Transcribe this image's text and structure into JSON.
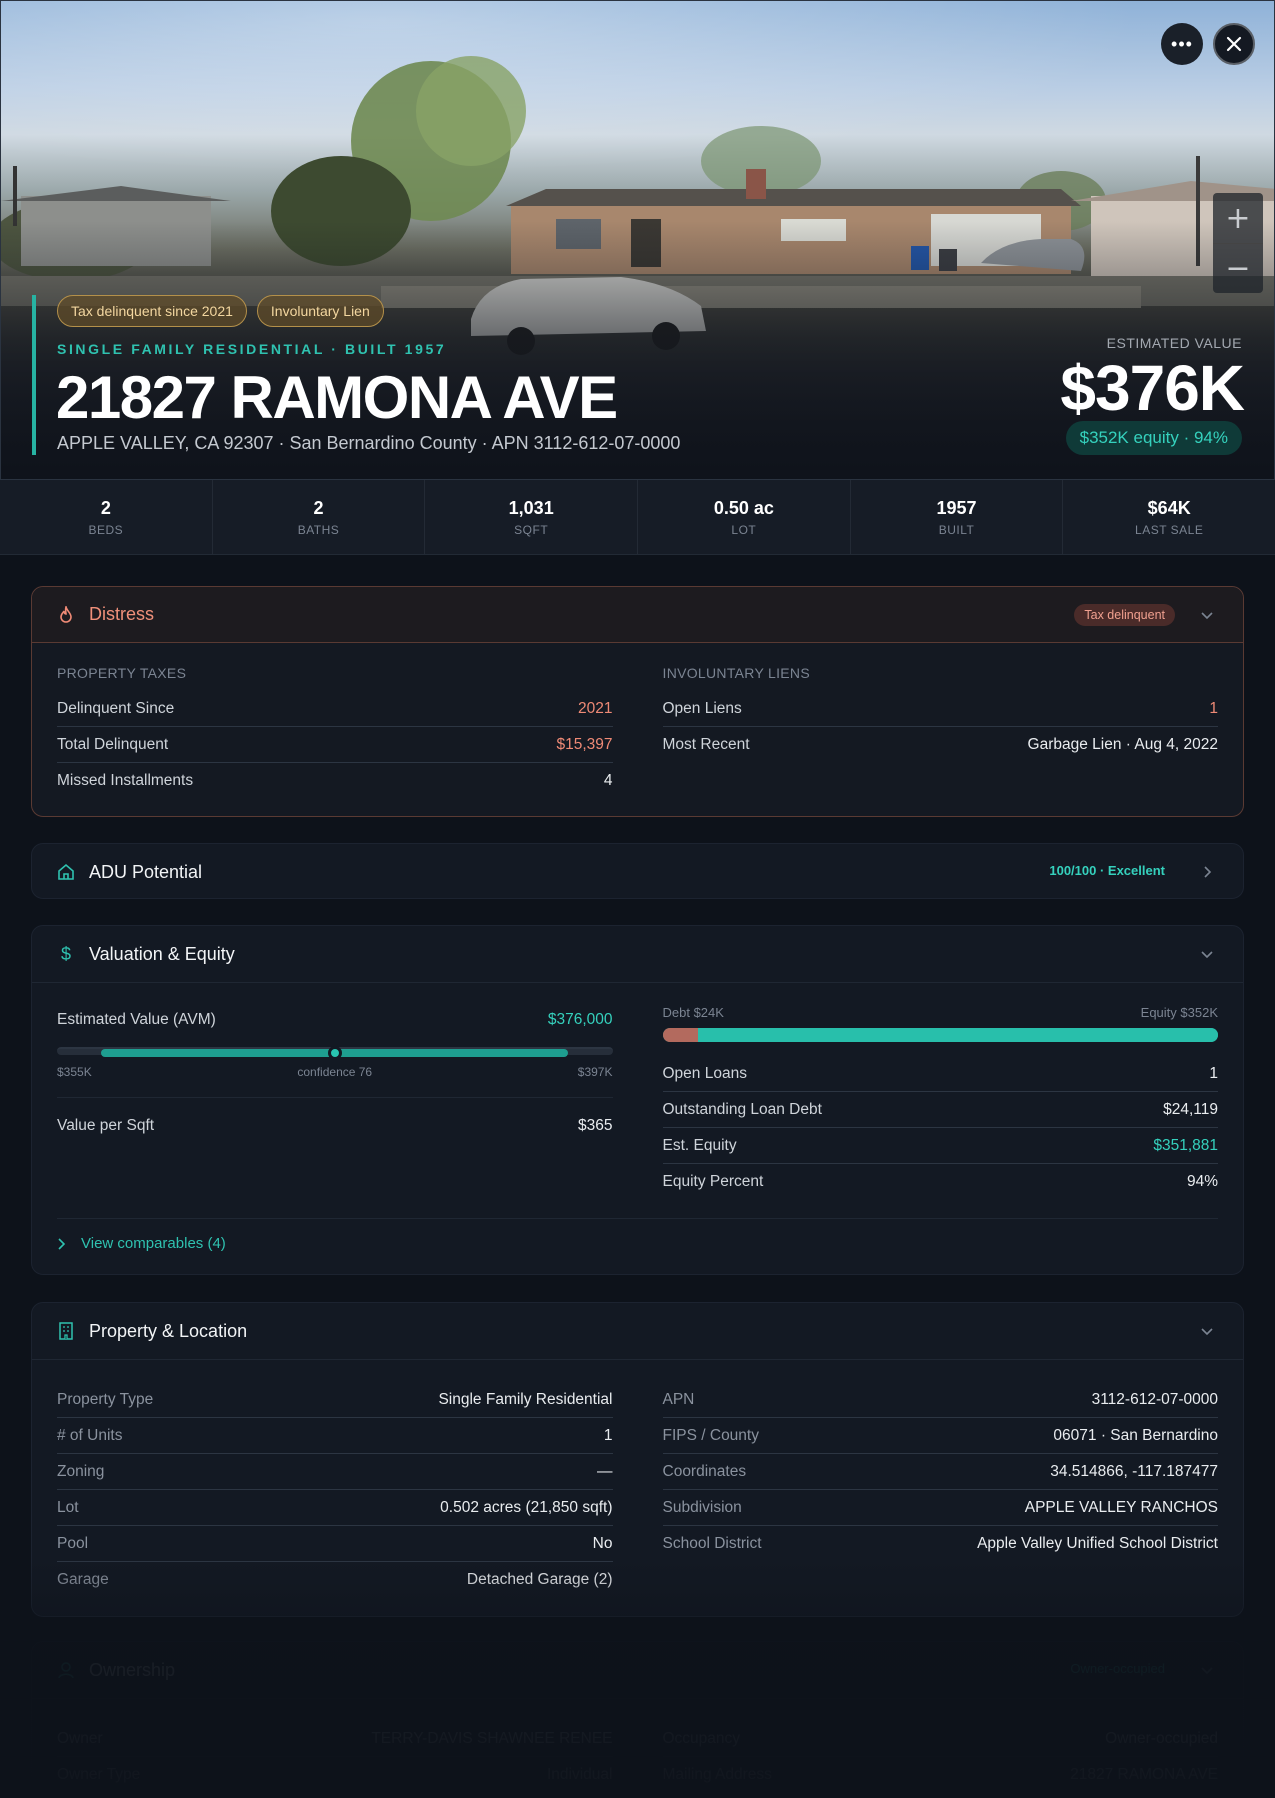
{
  "hero": {
    "badges": [
      "Tax delinquent since 2021",
      "Involuntary Lien"
    ],
    "subtitle": "SINGLE FAMILY RESIDENTIAL · BUILT 1957",
    "address": "21827 RAMONA AVE",
    "location": "APPLE VALLEY, CA 92307 · San Bernardino County · APN 3112-612-07-0000",
    "estimated_label": "ESTIMATED VALUE",
    "estimated_value": "$376K",
    "equity_pill": "$352K equity · 94%",
    "more_icon": "more-horizontal-icon",
    "close_icon": "close-icon",
    "zoom_in": "+",
    "zoom_out": "−"
  },
  "stats": [
    {
      "value": "2",
      "label": "BEDS"
    },
    {
      "value": "2",
      "label": "BATHS"
    },
    {
      "value": "1,031",
      "label": "SQFT"
    },
    {
      "value": "0.50 ac",
      "label": "LOT"
    },
    {
      "value": "1957",
      "label": "BUILT"
    },
    {
      "value": "$64K",
      "label": "LAST SALE"
    }
  ],
  "distress": {
    "title": "Distress",
    "pill": "Tax delinquent",
    "left_label": "PROPERTY TAXES",
    "left_rows": [
      {
        "label": "Delinquent Since",
        "value": "2021"
      },
      {
        "label": "Total Delinquent",
        "value": "$15,397"
      },
      {
        "label": "Missed Installments",
        "value": "4"
      }
    ],
    "right_label": "INVOLUNTARY LIENS",
    "right_rows": [
      {
        "label": "Open Liens",
        "value": "1"
      },
      {
        "label": "Most Recent",
        "value": "Garbage Lien · Aug 4, 2022"
      }
    ]
  },
  "adu": {
    "title": "ADU Potential",
    "score": "100/100 · Excellent"
  },
  "valuation": {
    "title": "Valuation & Equity",
    "avm_label": "Estimated Value (AVM)",
    "avm_value": "$376,000",
    "range_low": "$355K",
    "confidence": "confidence 76",
    "range_high": "$397K",
    "range_fill_start_pct": 8,
    "range_fill_end_pct": 92,
    "range_point_pct": 50,
    "per_sqft_label": "Value per Sqft",
    "per_sqft_value": "$365",
    "debt_label": "Debt $24K",
    "equity_label": "Equity $352K",
    "debt_fraction": 0.064,
    "rows": [
      {
        "label": "Open Loans",
        "value": "1"
      },
      {
        "label": "Outstanding Loan Debt",
        "value": "$24,119"
      },
      {
        "label": "Est. Equity",
        "value": "$351,881"
      },
      {
        "label": "Equity Percent",
        "value": "94%"
      }
    ],
    "comparables": "View comparables (4)"
  },
  "property": {
    "title": "Property & Location",
    "left_rows": [
      {
        "label": "Property Type",
        "value": "Single Family Residential"
      },
      {
        "label": "# of Units",
        "value": "1"
      },
      {
        "label": "Zoning",
        "value": "—"
      },
      {
        "label": "Lot",
        "value": "0.502 acres (21,850 sqft)"
      },
      {
        "label": "Pool",
        "value": "No"
      },
      {
        "label": "Garage",
        "value": "Detached Garage (2)"
      }
    ],
    "right_rows": [
      {
        "label": "APN",
        "value": "3112-612-07-0000"
      },
      {
        "label": "FIPS / County",
        "value": "06071 · San Bernardino"
      },
      {
        "label": "Coordinates",
        "value": "34.514866, -117.187477"
      },
      {
        "label": "Subdivision",
        "value": "APPLE VALLEY RANCHOS"
      },
      {
        "label": "School District",
        "value": "Apple Valley Unified School District"
      }
    ]
  },
  "ownership": {
    "title": "Ownership",
    "pill": "Owner-occupied",
    "left_rows": [
      {
        "label": "Owner",
        "value": "TERRY-DAVIS SHAWNEE RENEE"
      },
      {
        "label": "Owner Type",
        "value": "Individual"
      }
    ],
    "right_rows": [
      {
        "label": "Occupancy",
        "value": "Owner-occupied"
      },
      {
        "label": "Mailing Address",
        "value": "21827 RAMONA AVE"
      }
    ]
  },
  "colors": {
    "accent": "#2fc2b0",
    "danger": "#ef8a76",
    "badge": "#b4904a"
  }
}
